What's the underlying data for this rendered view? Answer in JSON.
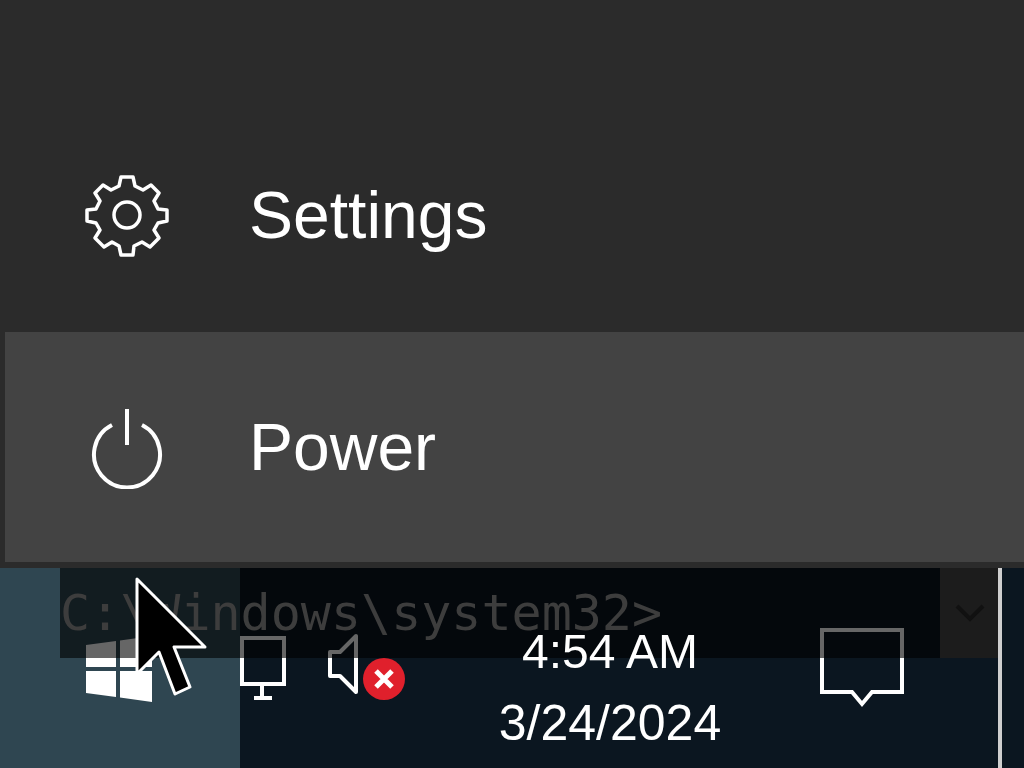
{
  "start_menu": {
    "items": [
      {
        "kind": "settings",
        "label": "Settings",
        "selected": false
      },
      {
        "kind": "power",
        "label": "Power",
        "selected": true
      }
    ]
  },
  "background_window": {
    "text": "C:\\Windows\\system32>"
  },
  "taskbar": {
    "start_hovered": true,
    "tray": [
      {
        "kind": "network"
      },
      {
        "kind": "volume",
        "muted": true
      }
    ],
    "clock": {
      "time": "4:54 AM",
      "date": "3/24/2024"
    }
  }
}
